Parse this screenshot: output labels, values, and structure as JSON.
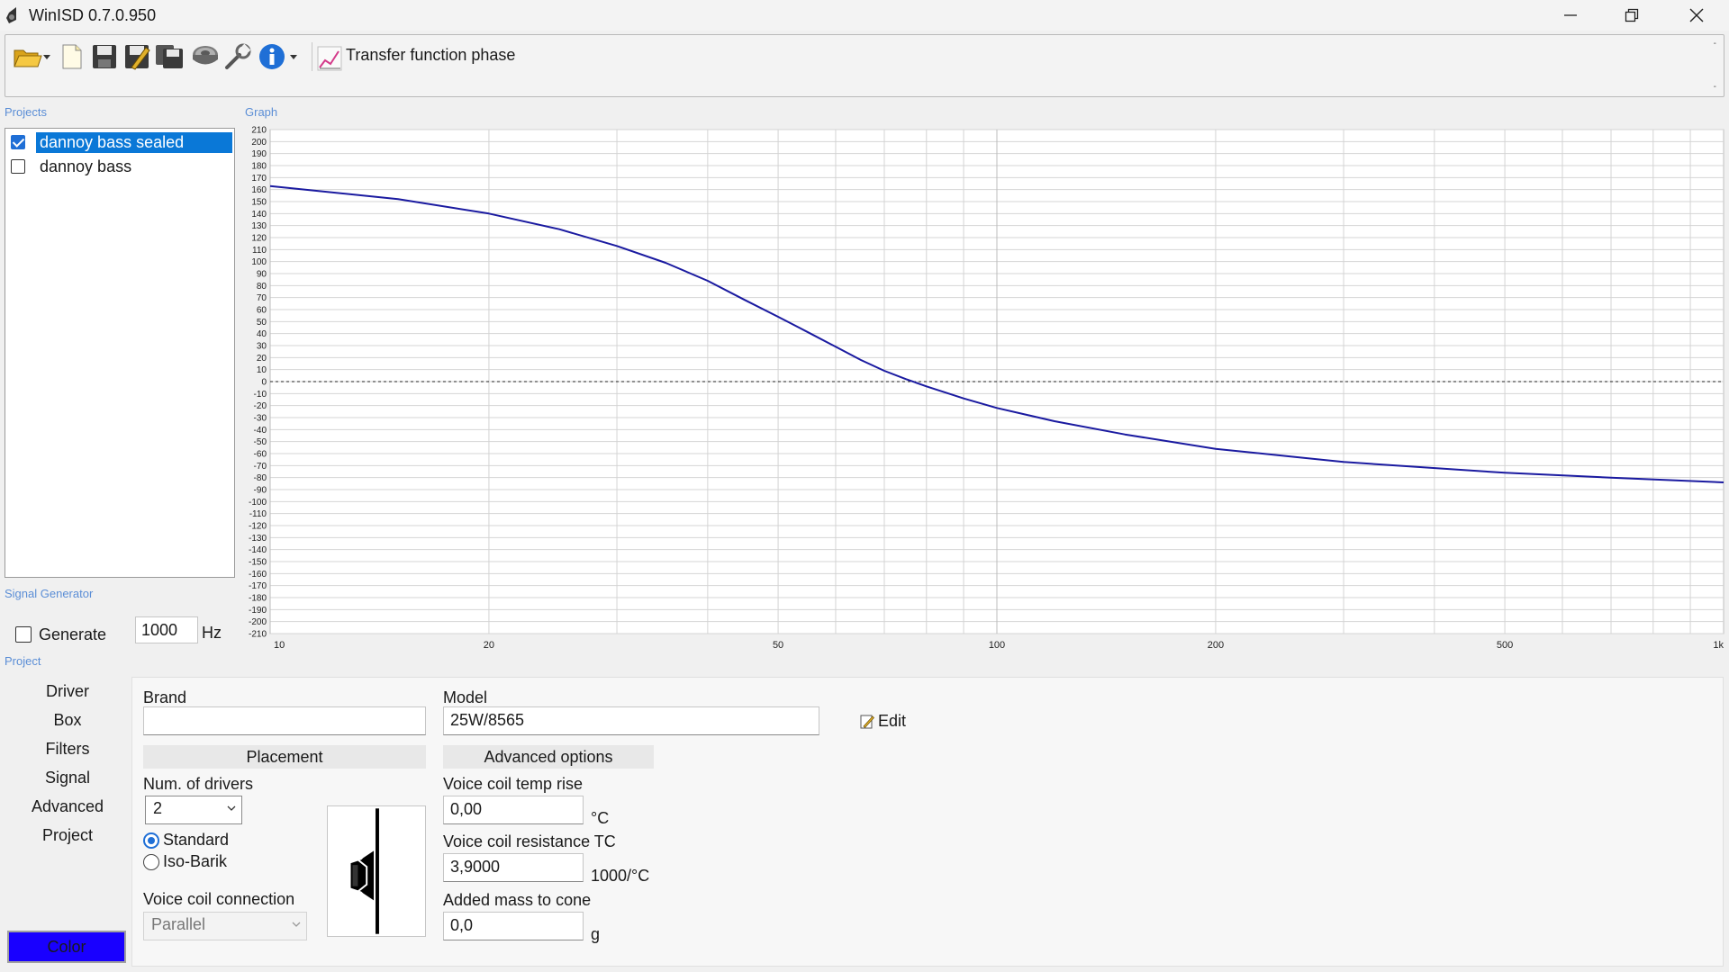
{
  "window": {
    "title": "WinISD 0.7.0.950"
  },
  "toolbar": {
    "transfer_label": "Transfer function phase",
    "icons": [
      "open-folder-icon",
      "new-document-icon",
      "save-icon",
      "save-as-icon",
      "save-all-icon",
      "driver-icon",
      "tools-icon",
      "info-icon",
      "chart-icon"
    ],
    "scroll_up": "-",
    "scroll_down": "-"
  },
  "sections": {
    "projects": "Projects",
    "graph": "Graph",
    "signal_generator": "Signal Generator",
    "project": "Project"
  },
  "projects": [
    {
      "label": "dannoy bass sealed",
      "checked": true,
      "selected": true
    },
    {
      "label": "dannoy bass",
      "checked": false,
      "selected": false
    }
  ],
  "signal_generator": {
    "generate_label": "Generate",
    "generate_checked": false,
    "frequency": "1000",
    "unit": "Hz"
  },
  "project_tabs": [
    "Driver",
    "Box",
    "Filters",
    "Signal",
    "Advanced",
    "Project"
  ],
  "color_button": {
    "label": "Color",
    "color": "#1900ff"
  },
  "driver_panel": {
    "brand_label": "Brand",
    "brand_value": "",
    "model_label": "Model",
    "model_value": "25W/8565",
    "edit_label": "Edit",
    "placement_header": "Placement",
    "advanced_header": "Advanced options",
    "num_drivers_label": "Num. of drivers",
    "num_drivers_value": "2",
    "radio_standard": "Standard",
    "radio_isobarik": "Iso-Barik",
    "radio_selected": "Standard",
    "voice_coil_connection_label": "Voice coil connection",
    "voice_coil_connection_value": "Parallel",
    "vc_temp_rise_label": "Voice coil temp rise",
    "vc_temp_rise_value": "0,00",
    "vc_temp_rise_unit": "°C",
    "vc_resistance_tc_label": "Voice coil resistance TC",
    "vc_resistance_tc_value": "3,9000",
    "vc_resistance_tc_unit": "1000/°C",
    "added_mass_label": "Added mass to cone",
    "added_mass_value": "0,0",
    "added_mass_unit": "g"
  },
  "chart_data": {
    "type": "line",
    "x_scale": "log",
    "xlim": [
      10,
      1000
    ],
    "ylim": [
      -210,
      210
    ],
    "x_ticks": [
      10,
      20,
      50,
      100,
      200,
      500,
      1000
    ],
    "x_tick_labels": [
      "10",
      "20",
      "50",
      "100",
      "200",
      "500",
      "1k"
    ],
    "y_ticks": [
      210,
      200,
      190,
      180,
      170,
      160,
      150,
      140,
      130,
      120,
      110,
      100,
      90,
      80,
      70,
      60,
      50,
      40,
      30,
      20,
      10,
      0,
      -10,
      -20,
      -30,
      -40,
      -50,
      -60,
      -70,
      -80,
      -90,
      -100,
      -110,
      -120,
      -130,
      -140,
      -150,
      -160,
      -170,
      -180,
      -190,
      -200,
      -210
    ],
    "grid": true,
    "zero_line": "dashed",
    "series": [
      {
        "color": "#1a1aa0",
        "x": [
          10,
          15,
          20,
          25,
          30,
          35,
          40,
          45,
          50,
          55,
          60,
          65,
          70,
          75,
          80,
          90,
          100,
          120,
          150,
          200,
          300,
          500,
          700,
          1000
        ],
        "y": [
          163,
          152,
          140,
          127,
          113,
          99,
          84,
          68,
          54,
          41,
          29,
          18,
          9,
          2,
          -4,
          -14,
          -22,
          -33,
          -44,
          -56,
          -67,
          -76,
          -80,
          -84
        ]
      }
    ]
  }
}
